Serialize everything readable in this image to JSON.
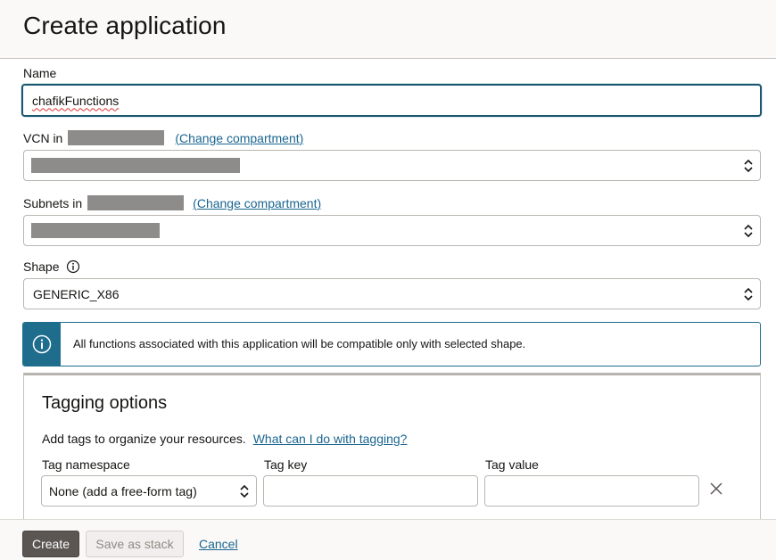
{
  "page": {
    "title": "Create application"
  },
  "name_field": {
    "label": "Name",
    "value": "chafikFunctions"
  },
  "vcn": {
    "label": "VCN in",
    "change_link": "(Change compartment)",
    "value": ""
  },
  "subnets": {
    "label": "Subnets in",
    "change_link": "(Change compartment)",
    "value": ""
  },
  "shape": {
    "label": "Shape",
    "value": "GENERIC_X86"
  },
  "info": {
    "message": "All functions associated with this application will be compatible only with selected shape."
  },
  "tagging": {
    "title": "Tagging options",
    "description": "Add tags to organize your resources.",
    "help_link": "What can I do with tagging?",
    "namespace_label": "Tag namespace",
    "namespace_value": "None (add a free-form tag)",
    "key_label": "Tag key",
    "key_value": "",
    "value_label": "Tag value",
    "value_value": ""
  },
  "footer": {
    "create": "Create",
    "save_stack": "Save as stack",
    "cancel": "Cancel"
  },
  "colors": {
    "accent": "#1f6d8d",
    "link": "#1a6590",
    "primary_button": "#5b5652"
  },
  "icons": [
    "info-icon",
    "updown-chevron-icon",
    "close-icon"
  ]
}
